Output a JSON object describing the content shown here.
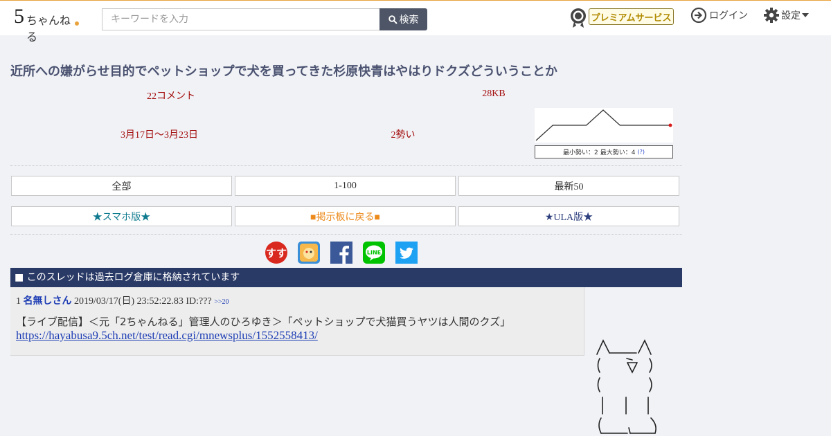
{
  "header": {
    "logo_text": "5ちゃんねる",
    "search_placeholder": "キーワードを入力",
    "search_button": "検索",
    "premium_label": "プレミアムサービス",
    "login_label": "ログイン",
    "settings_label": "設定"
  },
  "thread": {
    "title": "近所への嫌がらせ目的でペットショップで犬を買ってきた杉原快青はやはりドクズどういうことか",
    "comments": "22コメント",
    "size": "28KB",
    "dates": "3月17日〜3月23日",
    "ikioi": "2勢い",
    "ikioi_legend_min": "最小勢い：2",
    "ikioi_legend_max": "最大勢い：4",
    "ikioi_legend_help": "(?)",
    "ikioi_series": [
      0,
      2,
      2,
      2,
      4,
      2,
      2,
      2,
      2
    ]
  },
  "nav_buttons": [
    "全部",
    "1-100",
    "最新50"
  ],
  "nav_buttons2": [
    "★スマホ版★",
    "■掲示板に戻る■",
    "★ULA版★"
  ],
  "share_icons": [
    "sukusuku-icon",
    "appli-icon",
    "facebook-icon",
    "line-icon",
    "twitter-icon"
  ],
  "share_line_label": "LINE",
  "archived_notice": "■ このスレッドは過去ログ倉庫に格納されています",
  "post": {
    "number": "1",
    "name": "名無しさん",
    "datetime": "2019/03/17(日) 23:52:22.83",
    "id": "ID:???",
    "reply_ref": ">>20",
    "body": "【ライブ配信】＜元「2ちゃんねる」管理人のひろゆき＞「ペットショップで犬猫買うヤツは人間のクズ」",
    "link": "https://hayabusa9.5ch.net/test/read.cgi/mnewsplus/1552558413/"
  },
  "colors": {
    "accent_orange": "#e8a33c",
    "navy_bar": "#2a3a66",
    "stat_red": "#a30d0d",
    "link_blue": "#1c3cb4"
  }
}
